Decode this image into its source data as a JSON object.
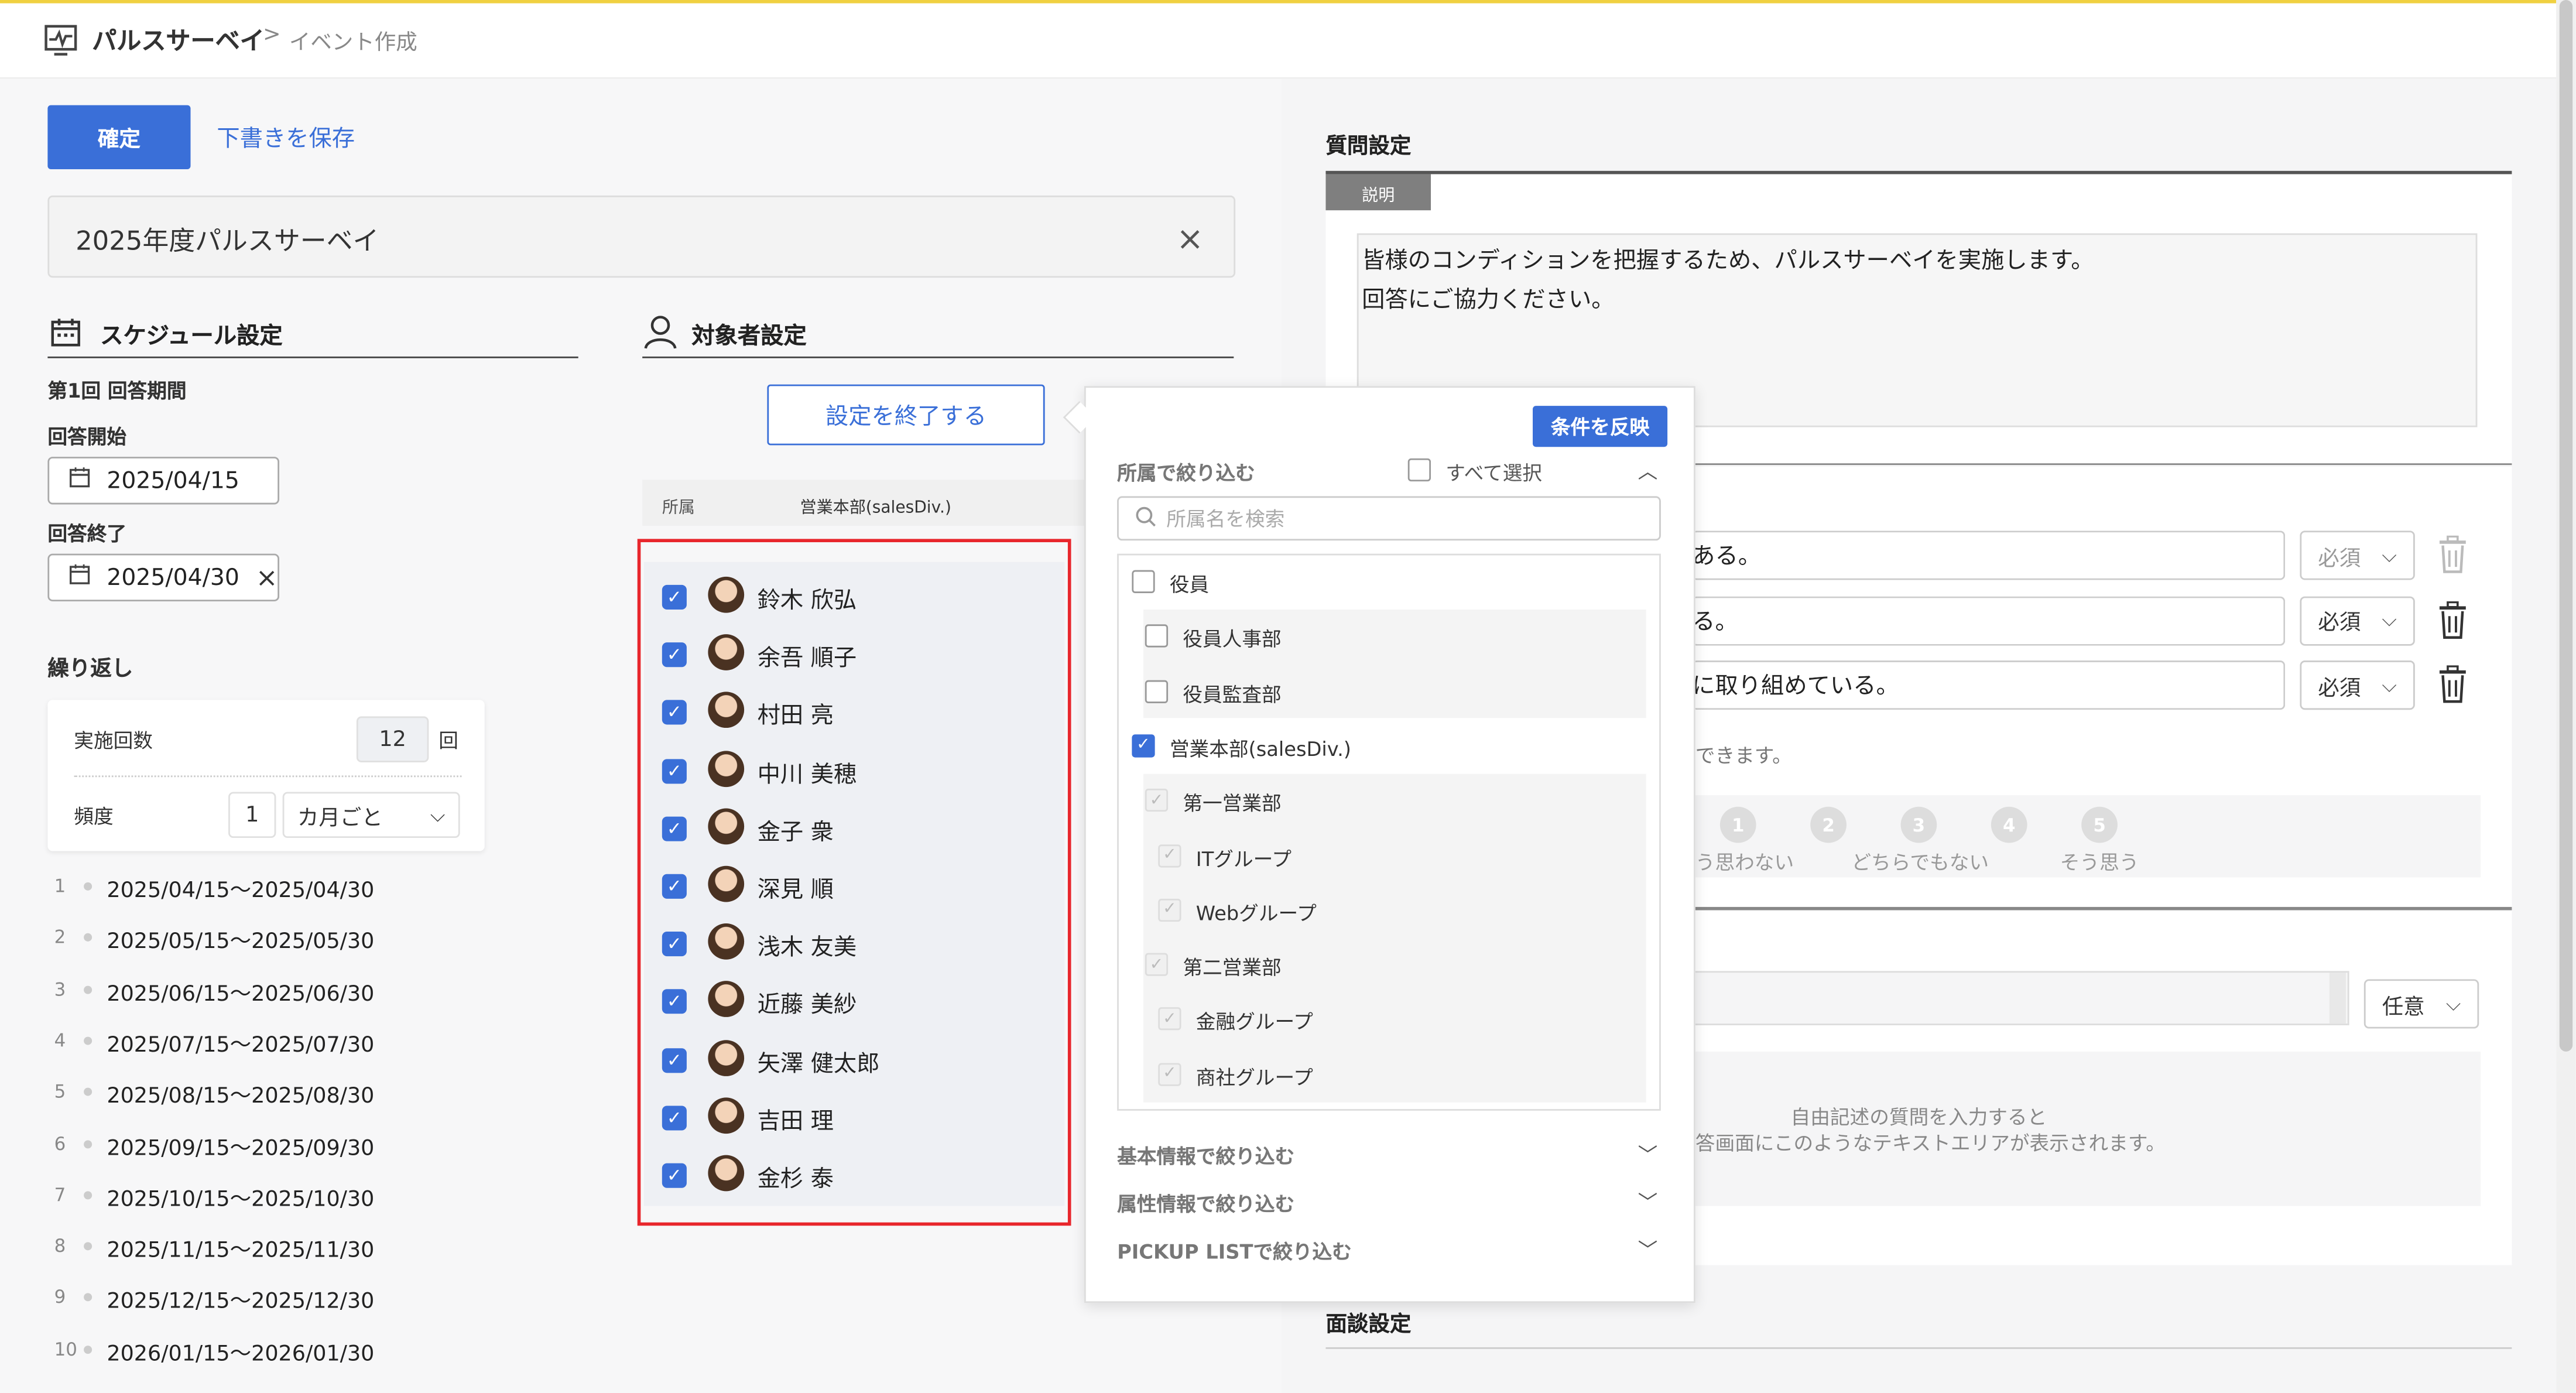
{
  "header": {
    "app": "パルスサーベイ",
    "separator": ">",
    "current": "イベント作成"
  },
  "actions": {
    "confirm": "確定",
    "save_draft": "下書きを保存"
  },
  "event_title": {
    "value": "2025年度パルスサーベイ",
    "clear": "×"
  },
  "schedule": {
    "title": "スケジュール設定",
    "period_title": "第1回 回答期間",
    "start_label": "回答開始",
    "start_date": "2025/04/15",
    "end_label": "回答終了",
    "end_date": "2025/04/30",
    "end_clear": "×",
    "repeat_label": "繰り返し",
    "count_label": "実施回数",
    "count_value": "12",
    "count_unit": "回",
    "freq_label": "頻度",
    "freq_value": "1",
    "freq_unit": "カ月ごと",
    "rows": [
      {
        "n": "1",
        "range": "2025/04/15～2025/04/30"
      },
      {
        "n": "2",
        "range": "2025/05/15～2025/05/30"
      },
      {
        "n": "3",
        "range": "2025/06/15～2025/06/30"
      },
      {
        "n": "4",
        "range": "2025/07/15～2025/07/30"
      },
      {
        "n": "5",
        "range": "2025/08/15～2025/08/30"
      },
      {
        "n": "6",
        "range": "2025/09/15～2025/09/30"
      },
      {
        "n": "7",
        "range": "2025/10/15～2025/10/30"
      },
      {
        "n": "8",
        "range": "2025/11/15～2025/11/30"
      },
      {
        "n": "9",
        "range": "2025/12/15～2025/12/30"
      },
      {
        "n": "10",
        "range": "2026/01/15～2026/01/30"
      }
    ]
  },
  "targets": {
    "title": "対象者設定",
    "end_button": "設定を終了する",
    "col_dept": "所属",
    "col_dept_value": "営業本部(salesDiv.)",
    "users": [
      "鈴木 欣弘",
      "余吾 順子",
      "村田 亮",
      "中川 美穂",
      "金子 衆",
      "深見 順",
      "浅木 友美",
      "近藤 美紗",
      "矢澤 健太郎",
      "吉田 理",
      "金杉 泰"
    ]
  },
  "filter": {
    "apply": "条件を反映",
    "dept_label": "所属で絞り込む",
    "select_all": "すべて選択",
    "search_placeholder": "所属名を検索",
    "tree": [
      {
        "label": "役員",
        "state": "empty",
        "level": 0
      },
      {
        "label": "役員人事部",
        "state": "empty",
        "level": 1
      },
      {
        "label": "役員監査部",
        "state": "empty",
        "level": 1
      },
      {
        "label": "営業本部(salesDiv.)",
        "state": "checked",
        "level": 0
      },
      {
        "label": "第一営業部",
        "state": "gray",
        "level": 1
      },
      {
        "label": "ITグループ",
        "state": "gray",
        "level": 2
      },
      {
        "label": "Webグループ",
        "state": "gray",
        "level": 2
      },
      {
        "label": "第二営業部",
        "state": "gray",
        "level": 1
      },
      {
        "label": "金融グループ",
        "state": "gray",
        "level": 2
      },
      {
        "label": "商社グループ",
        "state": "gray",
        "level": 2
      }
    ],
    "basic_label": "基本情報で絞り込む",
    "attr_label": "属性情報で絞り込む",
    "pickup_label": "PICKUP LISTで絞り込む"
  },
  "questions": {
    "title": "質問設定",
    "desc_tab": "説明",
    "desc_line1": "皆様のコンディションを把握するため、パルスサーベイを実施します。",
    "desc_line2": "回答にご協力ください。",
    "items": [
      {
        "text": "ある。",
        "req": "必須"
      },
      {
        "text": "る。",
        "req": "必須"
      },
      {
        "text": "に取り組めている。",
        "req": "必須"
      }
    ],
    "hint": "できます。",
    "scale": [
      {
        "n": "1",
        "label": "う思わない"
      },
      {
        "n": "2",
        "label": ""
      },
      {
        "n": "3",
        "label": "どちらでもない"
      },
      {
        "n": "4",
        "label": ""
      },
      {
        "n": "5",
        "label": "そう思う"
      }
    ],
    "optional": "任意",
    "free_hint1": "自由記述の質問を入力すると",
    "free_hint2": "答画面にこのようなテキストエリアが表示されます。",
    "interview_title": "面談設定"
  }
}
